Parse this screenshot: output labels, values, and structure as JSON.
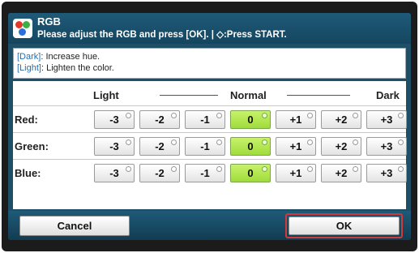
{
  "header": {
    "title": "RGB",
    "instruction": "Please adjust the RGB and press [OK]. | ◇:Press START."
  },
  "info": {
    "lines": [
      {
        "tag": "[Dark]",
        "text": ": Increase hue."
      },
      {
        "tag": "[Light]",
        "text": ": Lighten the color."
      }
    ]
  },
  "scale": {
    "left_label": "Light",
    "center_label": "Normal",
    "right_label": "Dark"
  },
  "levels": [
    "-3",
    "-2",
    "-1",
    "0",
    "+1",
    "+2",
    "+3"
  ],
  "channels": [
    {
      "label": "Red:",
      "selected": "0"
    },
    {
      "label": "Green:",
      "selected": "0"
    },
    {
      "label": "Blue:",
      "selected": "0"
    }
  ],
  "footer": {
    "cancel_label": "Cancel",
    "ok_label": "OK"
  },
  "colors": {
    "selected_button": "#9fdc3c",
    "title_bar": "#1e5a78",
    "focus_outline": "#d23a3a"
  },
  "icons": {
    "title": "rgb-color-dots-icon"
  }
}
